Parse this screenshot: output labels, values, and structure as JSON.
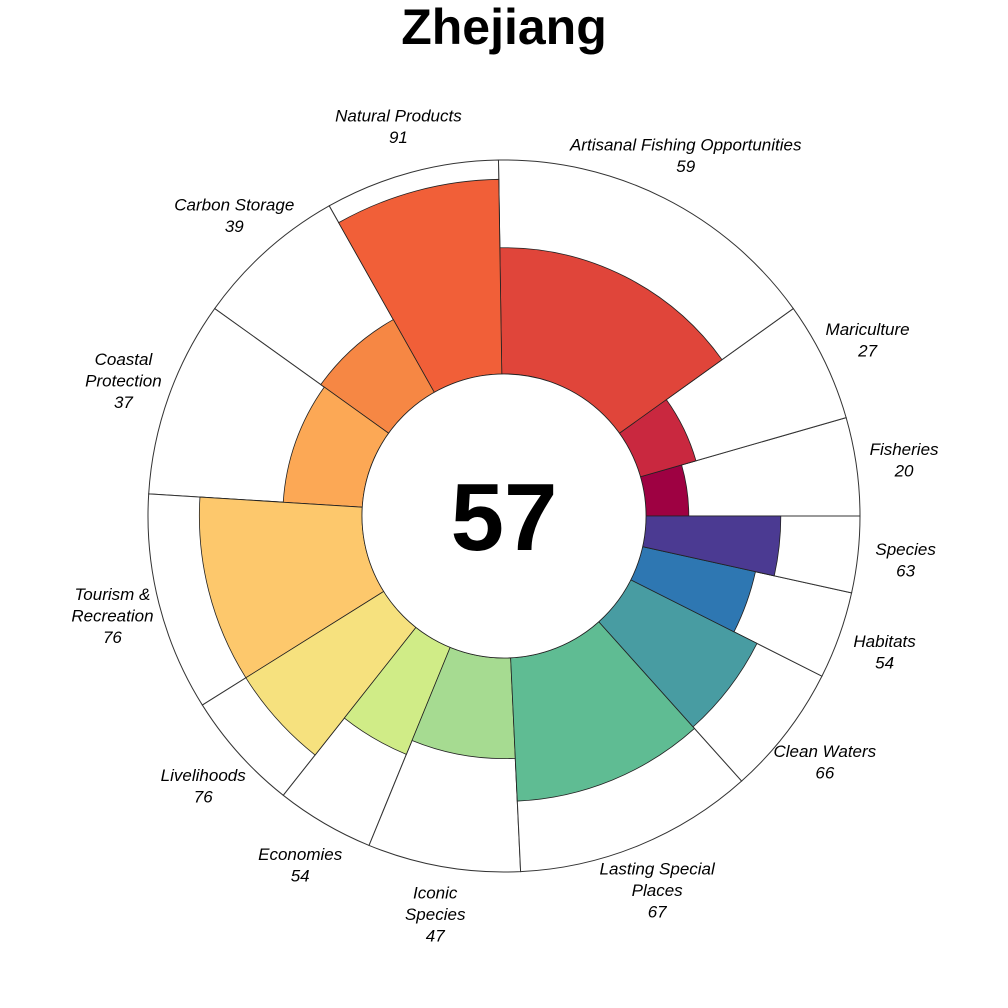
{
  "chart_data": {
    "type": "flower",
    "title": "Zhejiang",
    "score": 57,
    "petals": [
      {
        "name": "Fisheries",
        "lines": [
          "Fisheries"
        ],
        "value": 20,
        "color": "#9e0142"
      },
      {
        "name": "Mariculture",
        "lines": [
          "Mariculture"
        ],
        "value": 27,
        "color": "#c9283f"
      },
      {
        "name": "Artisanal Fishing Opportunities",
        "lines": [
          "Artisanal Fishing Opportunities"
        ],
        "value": 59,
        "color": "#e0453a"
      },
      {
        "name": "Natural Products",
        "lines": [
          "Natural Products"
        ],
        "value": 91,
        "color": "#f15f38"
      },
      {
        "name": "Carbon Storage",
        "lines": [
          "Carbon Storage"
        ],
        "value": 39,
        "color": "#f68744"
      },
      {
        "name": "Coastal Protection",
        "lines": [
          "Coastal",
          "Protection"
        ],
        "value": 37,
        "color": "#fca855"
      },
      {
        "name": "Tourism & Recreation",
        "lines": [
          "Tourism &",
          "Recreation"
        ],
        "value": 76,
        "color": "#fdc86c"
      },
      {
        "name": "Livelihoods",
        "lines": [
          "Livelihoods"
        ],
        "value": 76,
        "color": "#f6e17e"
      },
      {
        "name": "Economies",
        "lines": [
          "Economies"
        ],
        "value": 54,
        "color": "#d0ec87"
      },
      {
        "name": "Iconic Species",
        "lines": [
          "Iconic",
          "Species"
        ],
        "value": 47,
        "color": "#a6db91"
      },
      {
        "name": "Lasting Special Places",
        "lines": [
          "Lasting Special",
          "Places"
        ],
        "value": 67,
        "color": "#5fbc93"
      },
      {
        "name": "Clean Waters",
        "lines": [
          "Clean Waters"
        ],
        "value": 66,
        "color": "#489ca2"
      },
      {
        "name": "Habitats",
        "lines": [
          "Habitats"
        ],
        "value": 54,
        "color": "#2e77b2"
      },
      {
        "name": "Species",
        "lines": [
          "Species"
        ],
        "value": 63,
        "color": "#4b3a92"
      }
    ]
  }
}
